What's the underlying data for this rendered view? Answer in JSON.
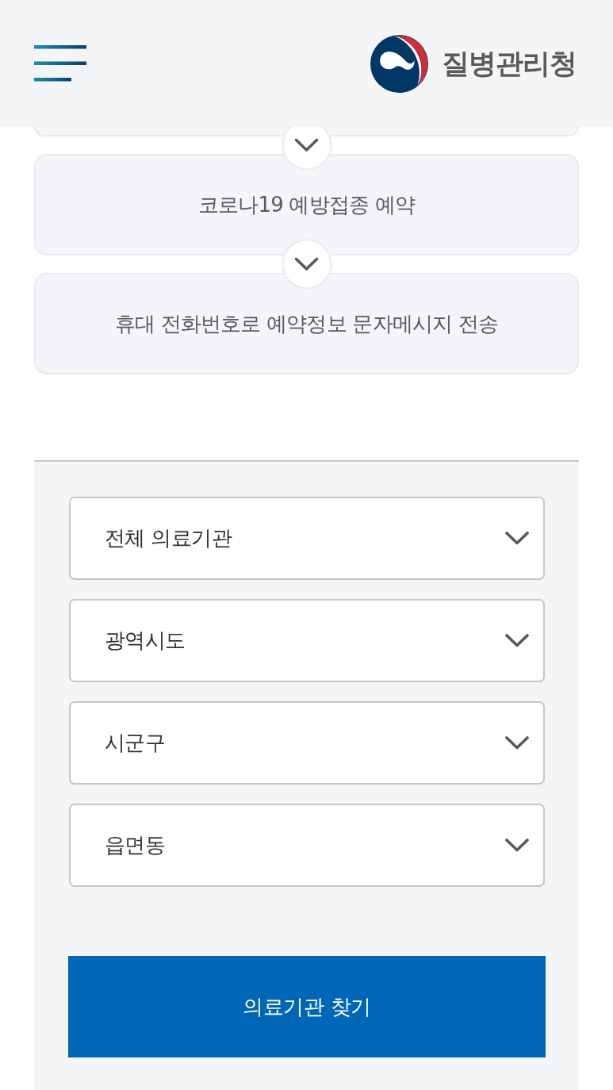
{
  "header": {
    "logo_text": "질병관리청"
  },
  "steps": [
    {
      "label": "코로나19 예방접종 예약"
    },
    {
      "label": "휴대 전화번호로 예약정보 문자메시지 전송"
    }
  ],
  "filters": [
    {
      "value": "전체 의료기관"
    },
    {
      "value": "광역시도"
    },
    {
      "value": "시군구"
    },
    {
      "value": "읍면동"
    }
  ],
  "search_button": {
    "label": "의료기관 찾기"
  }
}
